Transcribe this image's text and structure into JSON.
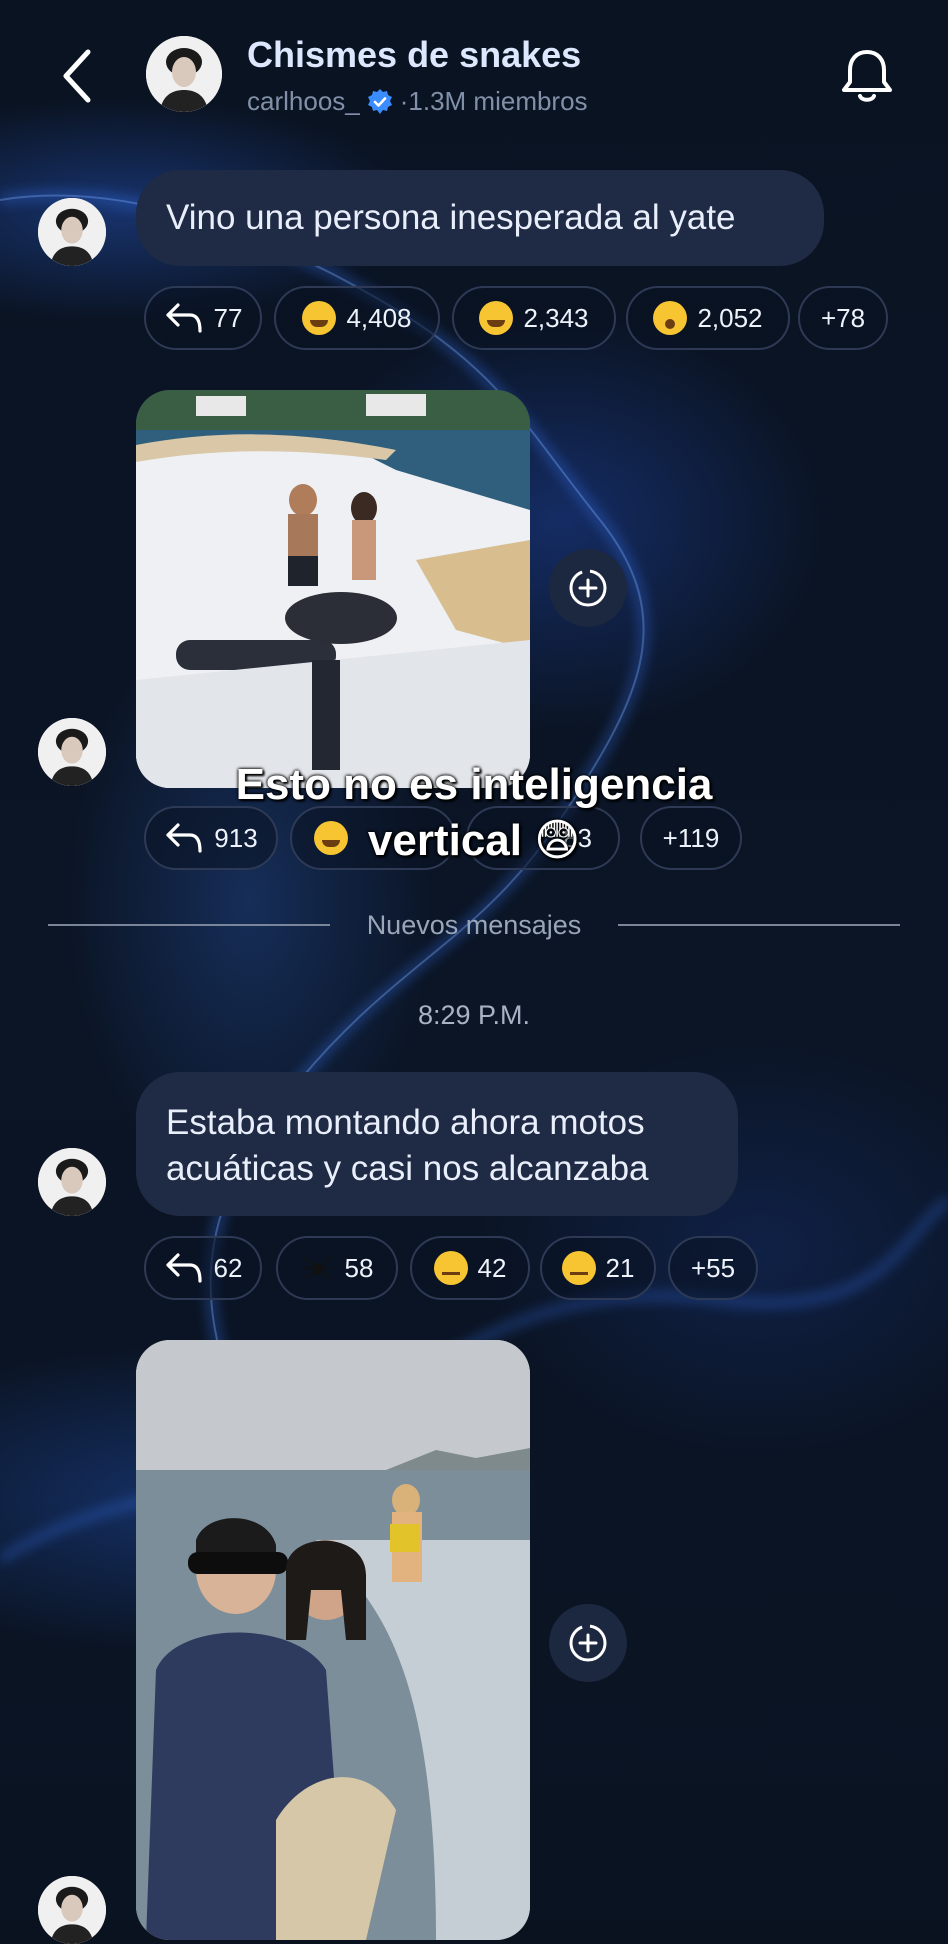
{
  "header": {
    "title": "Chismes de snakes",
    "username": "carlhoos_",
    "members": "·1.3M miembros"
  },
  "messages": [
    {
      "text": "Vino una persona inesperada al yate",
      "reactions": {
        "replies": "77",
        "r1": "4,408",
        "r1_icon": "tears-of-joy-emoji",
        "r2": "2,343",
        "r2_icon": "laughing-squint-emoji",
        "r3": "2,052",
        "r3_icon": "surprised-emoji",
        "more": "+78"
      }
    },
    {
      "image": "yacht-photo",
      "reactions": {
        "replies": "913",
        "r3": "83",
        "more": "+119"
      }
    },
    {
      "text": "Estaba montando ahora motos acuáticas y casi nos alcanzaba",
      "reactions": {
        "replies": "62",
        "r1": "58",
        "r1_icon": "spider-emoji",
        "r2": "42",
        "r2_icon": "woozy-face-emoji",
        "r3": "21",
        "r3_icon": "raised-eyebrow-emoji",
        "more": "+55"
      }
    },
    {
      "image": "jetski-photo"
    }
  ],
  "divider": {
    "label": "Nuevos mensajes"
  },
  "timestamp": "8:29 P.M.",
  "overlay": {
    "line1": "Esto no es inteligencia",
    "line2": "vertical 😨"
  },
  "colors": {
    "accent": "#dde8ff",
    "bubble": "#1f2a44",
    "background": "#0a1220"
  }
}
